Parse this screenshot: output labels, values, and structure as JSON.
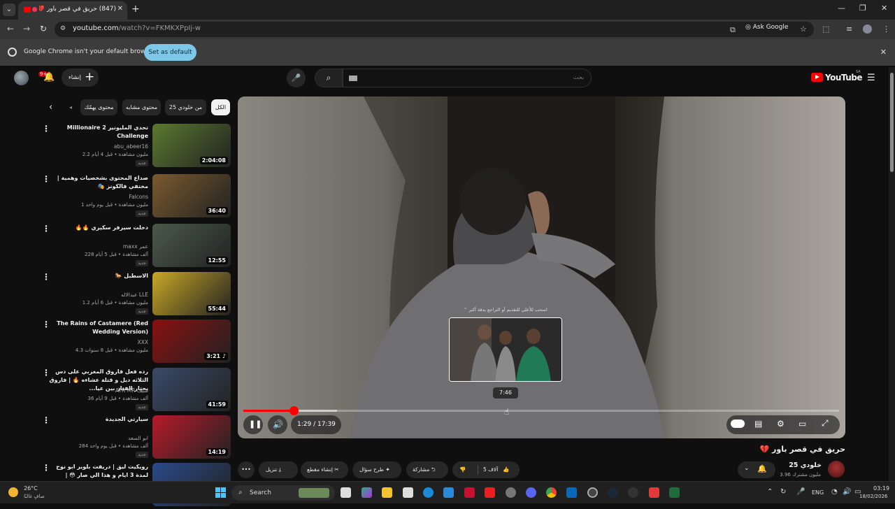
{
  "browser": {
    "tab_title": "(847) حريق في قصر باور 💔",
    "url_host": "youtube.com",
    "url_path": "/watch?v=FKMKXPpIj-w",
    "ask_google": "Ask Google",
    "infobar_message": "Google Chrome isn't your default browser",
    "infobar_button": "Set as default"
  },
  "masthead": {
    "notif_count": "9+",
    "create_label": "إنشاء",
    "search_placeholder": "بحث",
    "logo_text": "YouTube",
    "region": "SA"
  },
  "chips": [
    {
      "label": "الكل",
      "active": true
    },
    {
      "label": "من خلودي 25",
      "active": false
    },
    {
      "label": "محتوى مشابه",
      "active": false
    },
    {
      "label": "محتوى يهمّك",
      "active": false
    }
  ],
  "related": [
    {
      "title": "تحدي المليونير 2 Millionaire Challenge",
      "channel": "abu_abeer16",
      "meta": "2.2 مليون مشاهدة • قبل 4 أيام",
      "badge": "جديد",
      "duration": "2:04:08",
      "thumb_color": "#5a7a2e"
    },
    {
      "title": "صداع المحتوى بشخصيات وهمية | مختفي فالكونز 🎭",
      "channel": "Falcons",
      "meta": "1 مليون مشاهدة • قبل يوم واحد",
      "badge": "جديد",
      "duration": "36:40",
      "thumb_color": "#7a5a2e"
    },
    {
      "title": "دخلت سيرفر سكيري 🔥🔥",
      "channel": "maxx عمر",
      "meta": "228 ألف مشاهدة • قبل 5 أيام",
      "badge": "جديد",
      "duration": "12:55",
      "thumb_color": "#4a5a4a"
    },
    {
      "title": "الاسطبل 🐎",
      "channel": "عبدالاله LLE",
      "meta": "1.2 مليون مشاهدة • قبل 6 أيام",
      "badge": "جديد",
      "duration": "55:44",
      "thumb_color": "#c8a826"
    },
    {
      "title": "The Rains of Castamere (Red Wedding Version)",
      "channel": "XXX",
      "meta": "4.3 مليون مشاهدة • قبل 8 سنوات",
      "badge": "",
      "duration": "3:21 ♪",
      "thumb_color": "#8a1010"
    },
    {
      "title": "رده فعل فاروق المغربي على دس الثلاثه ديل و قتلة عشاءه 🔥 | فاروق يحتار الفتاز بين عيا...",
      "channel": "ATR MR سيف",
      "meta": "36 ألف مشاهدة • قبل 9 أيام",
      "badge": "جديد",
      "duration": "41:59",
      "thumb_color": "#3a4a6a"
    },
    {
      "title": "سيارتي الجديدة",
      "channel": "ابو السعد",
      "meta": "284 ألف مشاهدة • قبل يوم واحد",
      "badge": "جديد",
      "duration": "14:19",
      "thumb_color": "#b81a2a"
    },
    {
      "title": "رويكيت ليق | دريفت بلوير ابو نوح لمدة 3 ايام و هذا الي صار 😳 | Rocket League",
      "channel": "",
      "meta": "",
      "badge": "",
      "duration": "",
      "thumb_color": "#2a4a8a"
    }
  ],
  "player": {
    "drag_hint": "اسحب للأعلى للتقديم أو التراجع بدقة أكبر",
    "preview_time": "7:46",
    "time_display": "1:29 / 17:39",
    "progress": 0.084,
    "buffered": 0.157,
    "hover": 0.442
  },
  "video": {
    "title": "حريق في قصر باور 💔",
    "channel_name": "خلودي 25",
    "subscribers": "3.96 مليون مشترك",
    "likes": "5 آلاف",
    "share": "مشاركة",
    "ask": "طرح سؤال",
    "clip": "إنشاء مقطع",
    "download": "تنزيل"
  },
  "taskbar": {
    "temp": "26°C",
    "weather": "صافٍ غالبًا",
    "search": "Search",
    "lang": "ENG",
    "time": "03:19",
    "date": "18/02/2026"
  }
}
